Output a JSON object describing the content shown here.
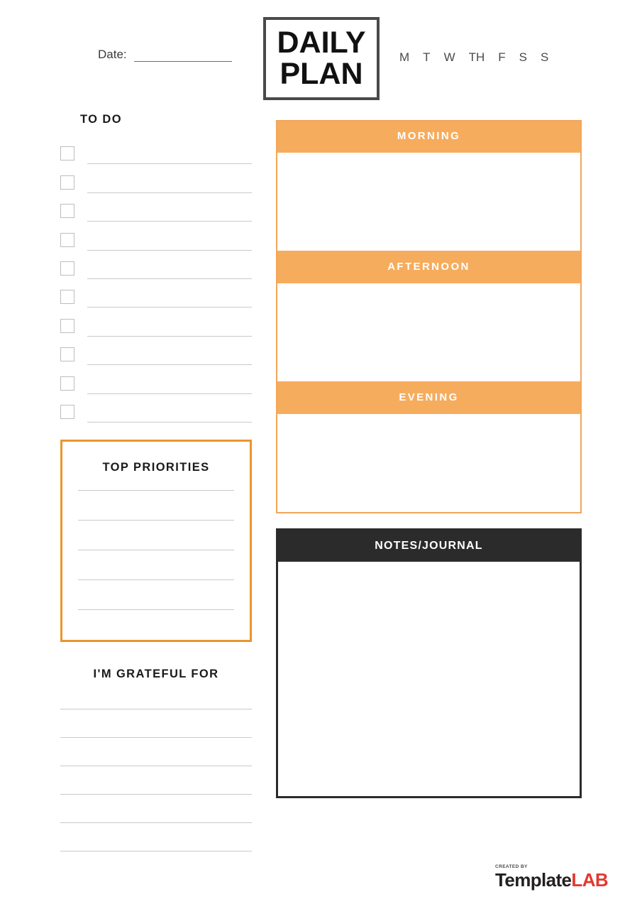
{
  "header": {
    "date_label": "Date:",
    "date_value": "",
    "title_line1": "DAILY",
    "title_line2": "PLAN",
    "weekdays": [
      "M",
      "T",
      "W",
      "TH",
      "F",
      "S",
      "S"
    ]
  },
  "todo": {
    "title": "TO DO",
    "item_count": 10,
    "items": [
      "",
      "",
      "",
      "",
      "",
      "",
      "",
      "",
      "",
      ""
    ]
  },
  "priorities": {
    "title": "TOP PRIORITIES",
    "line_count": 5,
    "items": [
      "",
      "",
      "",
      "",
      ""
    ]
  },
  "grateful": {
    "title": "I'M GRATEFUL FOR",
    "line_count": 6,
    "items": [
      "",
      "",
      "",
      "",
      "",
      ""
    ]
  },
  "schedule": {
    "slots": [
      {
        "label": "MORNING",
        "value": ""
      },
      {
        "label": "AFTERNOON",
        "value": ""
      },
      {
        "label": "EVENING",
        "value": ""
      }
    ]
  },
  "notes": {
    "title": "NOTES/JOURNAL",
    "value": ""
  },
  "footer": {
    "created_by": "CREATED BY",
    "brand_first": "Template",
    "brand_second": "LAB"
  },
  "colors": {
    "accent_orange": "#F6AC5D",
    "border_orange": "#E8962E",
    "dark": "#2b2b2b",
    "brand_red": "#E03A31",
    "line_gray": "#c9c9c9"
  }
}
